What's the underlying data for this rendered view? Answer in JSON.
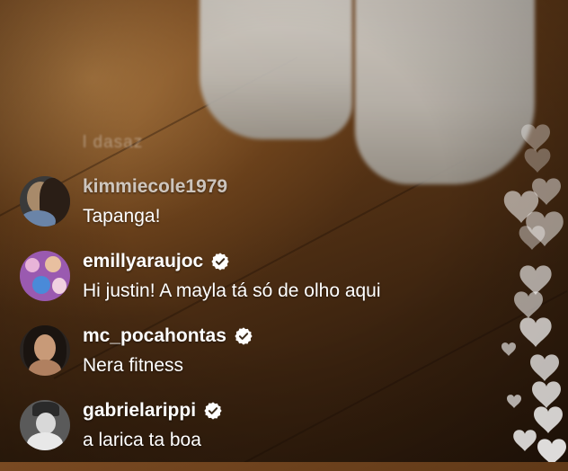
{
  "stream": {
    "background_text": "l dasaz"
  },
  "comments": [
    {
      "username": "kimmiecole1979",
      "verified": false,
      "faded": true,
      "message": "Tapanga!",
      "avatar_colors": [
        "#3a3a3a",
        "#a88a6a",
        "#6a84a8"
      ]
    },
    {
      "username": "emillyaraujoc",
      "verified": true,
      "faded": false,
      "message": "Hi justin! A mayla tá só de olho aqui",
      "avatar_colors": [
        "#9a5ab0",
        "#e8b4d8",
        "#4a8ad8"
      ]
    },
    {
      "username": "mc_pocahontas",
      "verified": true,
      "faded": false,
      "message": "Nera fitness",
      "avatar_colors": [
        "#2a2420",
        "#c89a78",
        "#5a3a2a"
      ]
    },
    {
      "username": "gabrielarippi",
      "verified": true,
      "faded": false,
      "message": "a larica ta boa",
      "avatar_colors": [
        "#5a5a5a",
        "#d8d8d8",
        "#2a2a2a"
      ]
    }
  ],
  "colors": {
    "text": "#ffffff",
    "verified_badge": "#ffffff",
    "heart": "#ffffff"
  }
}
